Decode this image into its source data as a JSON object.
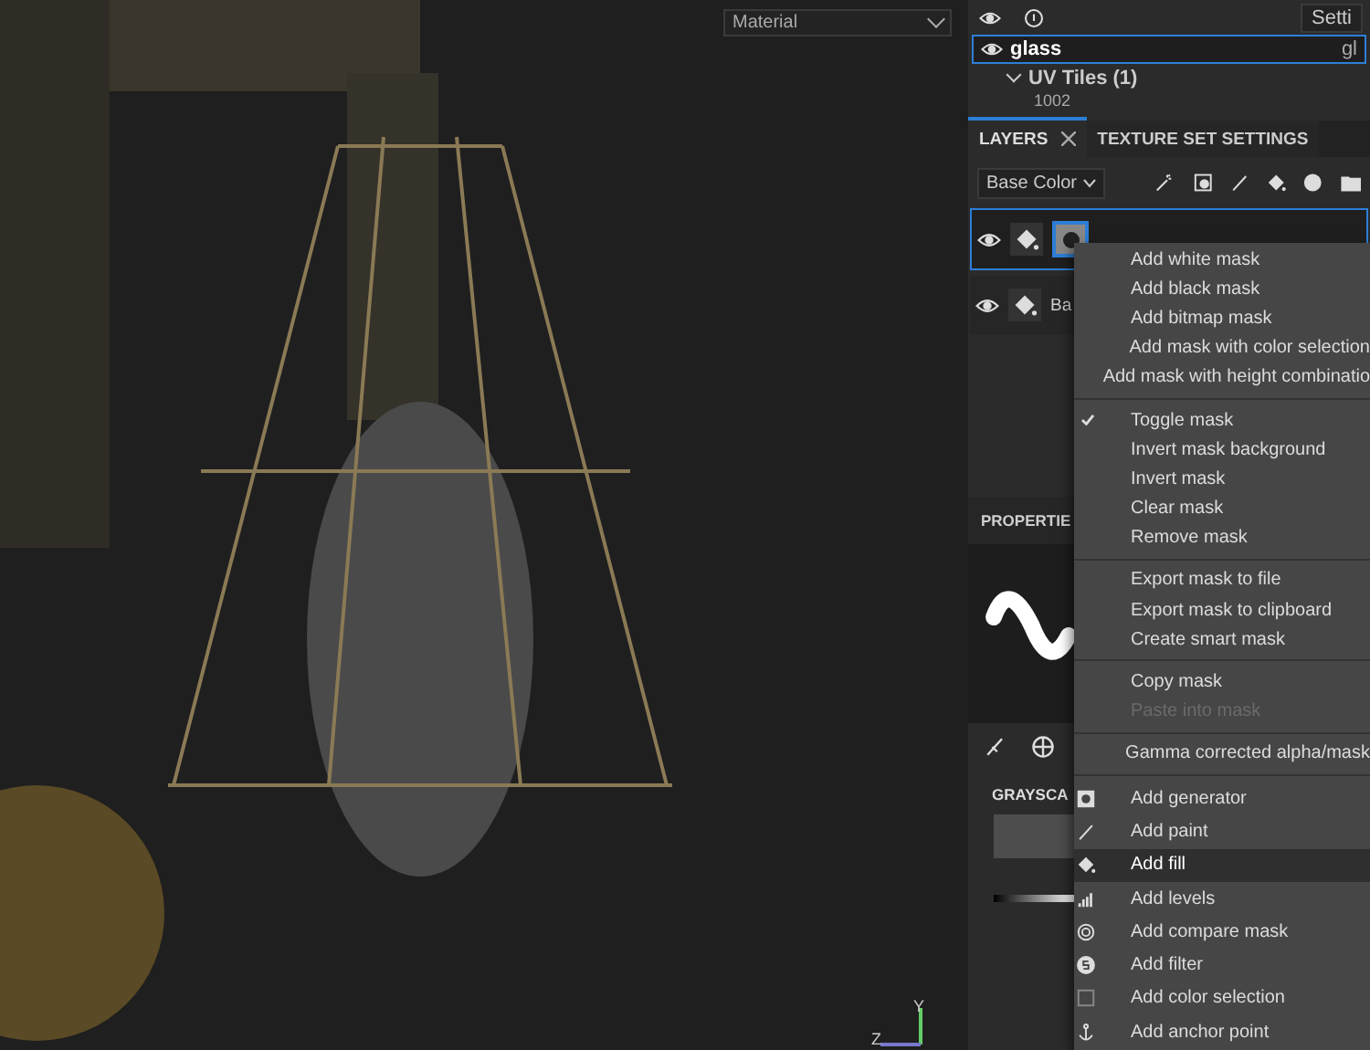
{
  "viewport": {
    "material_dropdown": "Material",
    "axis_labels": [
      "Y",
      "Z"
    ]
  },
  "top_bar": {
    "settings_button": "Setti"
  },
  "texture_sets": [
    {
      "name": "glass",
      "trailing": "gl",
      "selected": true
    }
  ],
  "uv_tiles": {
    "label": "UV Tiles (1)",
    "expanded": true,
    "tiles": [
      "1002"
    ]
  },
  "tabs": [
    {
      "label": "LAYERS",
      "selected": true,
      "closable": true
    },
    {
      "label": "TEXTURE SET SETTINGS",
      "selected": false,
      "closable": false
    }
  ],
  "channel_dropdown": "Base Color",
  "layers": [
    {
      "selected": true,
      "has_mask": true
    },
    {
      "name": "Ba",
      "selected": false,
      "has_mask": false
    }
  ],
  "properties": {
    "title": "PROPERTIE",
    "section": "GRAYSCA"
  },
  "context_menu": {
    "sections": [
      [
        {
          "label": "Add white mask",
          "checked": false,
          "disabled": false,
          "selected": false
        },
        {
          "label": "Add black mask",
          "checked": false,
          "disabled": false,
          "selected": false
        },
        {
          "label": "Add bitmap mask",
          "checked": false,
          "disabled": false,
          "selected": false
        },
        {
          "label": "Add mask with color selection",
          "checked": false,
          "disabled": false,
          "selected": false
        },
        {
          "label": "Add mask with height combinatio",
          "checked": false,
          "disabled": false,
          "selected": false
        }
      ],
      [
        {
          "label": "Toggle mask",
          "checked": true,
          "disabled": false,
          "selected": false
        },
        {
          "label": "Invert mask background",
          "checked": false,
          "disabled": false,
          "selected": false
        },
        {
          "label": "Invert mask",
          "checked": false,
          "disabled": false,
          "selected": false
        },
        {
          "label": "Clear mask",
          "checked": false,
          "disabled": false,
          "selected": false
        },
        {
          "label": "Remove mask",
          "checked": false,
          "disabled": false,
          "selected": false
        }
      ],
      [
        {
          "label": "Export mask to file",
          "checked": false,
          "disabled": false,
          "selected": false
        },
        {
          "label": "Export mask to clipboard",
          "checked": false,
          "disabled": false,
          "selected": false
        },
        {
          "label": "Create smart mask",
          "checked": false,
          "disabled": false,
          "selected": false
        }
      ],
      [
        {
          "label": "Copy mask",
          "checked": false,
          "disabled": false,
          "selected": false
        },
        {
          "label": "Paste into mask",
          "checked": false,
          "disabled": true,
          "selected": false
        }
      ],
      [
        {
          "label": "Gamma corrected alpha/mask",
          "checked": false,
          "disabled": false,
          "selected": false
        }
      ],
      [
        {
          "label": "Add generator",
          "checked": false,
          "disabled": false,
          "selected": false
        },
        {
          "label": "Add paint",
          "checked": false,
          "disabled": false,
          "selected": false
        },
        {
          "label": "Add fill",
          "checked": false,
          "disabled": false,
          "selected": true
        },
        {
          "label": "Add levels",
          "checked": false,
          "disabled": false,
          "selected": false
        },
        {
          "label": "Add compare mask",
          "checked": false,
          "disabled": false,
          "selected": false
        },
        {
          "label": "Add filter",
          "checked": false,
          "disabled": false,
          "selected": false
        },
        {
          "label": "Add color selection",
          "checked": false,
          "disabled": false,
          "selected": false
        },
        {
          "label": "Add anchor point",
          "checked": false,
          "disabled": false,
          "selected": false
        }
      ]
    ]
  }
}
